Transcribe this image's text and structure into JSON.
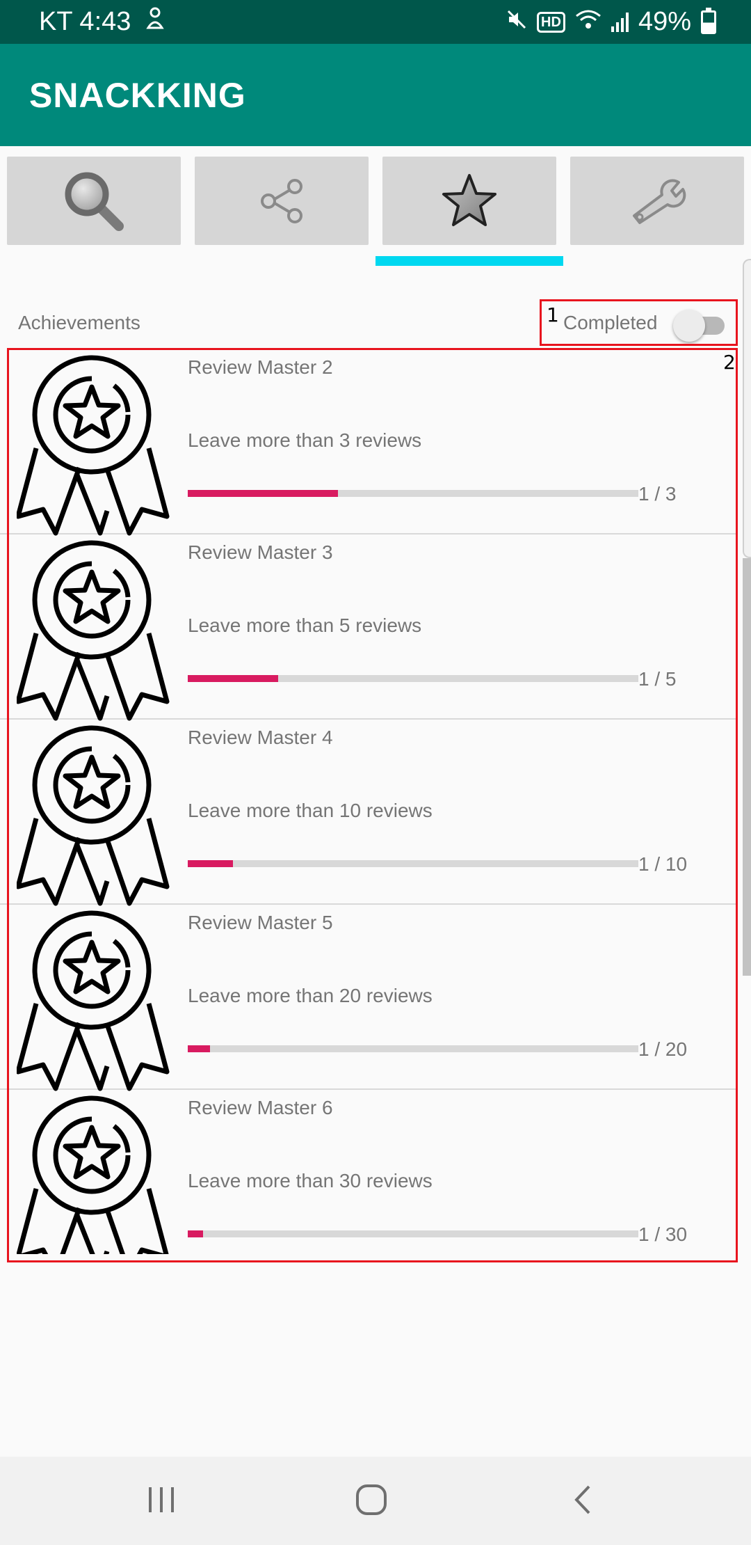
{
  "status_bar": {
    "carrier_time": "KT 4:43",
    "battery": "49%",
    "hd": "HD"
  },
  "app_bar": {
    "title": "SNACKKING"
  },
  "tabs": [
    {
      "icon": "search-icon",
      "selected": false
    },
    {
      "icon": "share-icon",
      "selected": false
    },
    {
      "icon": "star-icon",
      "selected": true
    },
    {
      "icon": "wrench-icon",
      "selected": false
    }
  ],
  "header": {
    "section_label": "Achievements",
    "completed_label": "Completed",
    "completed_toggle_on": false
  },
  "annotations": {
    "box1": "1",
    "box2": "2"
  },
  "achievements": [
    {
      "title": "Review Master 2",
      "description": "Leave more than 3 reviews",
      "progress": 1,
      "goal": 3,
      "progress_text": "1 / 3"
    },
    {
      "title": "Review Master 3",
      "description": "Leave more than 5 reviews",
      "progress": 1,
      "goal": 5,
      "progress_text": "1 / 5"
    },
    {
      "title": "Review Master 4",
      "description": "Leave more than 10 reviews",
      "progress": 1,
      "goal": 10,
      "progress_text": "1 / 10"
    },
    {
      "title": "Review Master 5",
      "description": "Leave more than 20 reviews",
      "progress": 1,
      "goal": 20,
      "progress_text": "1 / 20"
    },
    {
      "title": "Review Master 6",
      "description": "Leave more than 30 reviews",
      "progress": 1,
      "goal": 30,
      "progress_text": "1 / 30"
    }
  ],
  "colors": {
    "status_bar": "#00574b",
    "app_bar": "#00897b",
    "tab_indicator": "#00d8f0",
    "progress_fill": "#d81b60",
    "annotation": "#e8141e"
  }
}
